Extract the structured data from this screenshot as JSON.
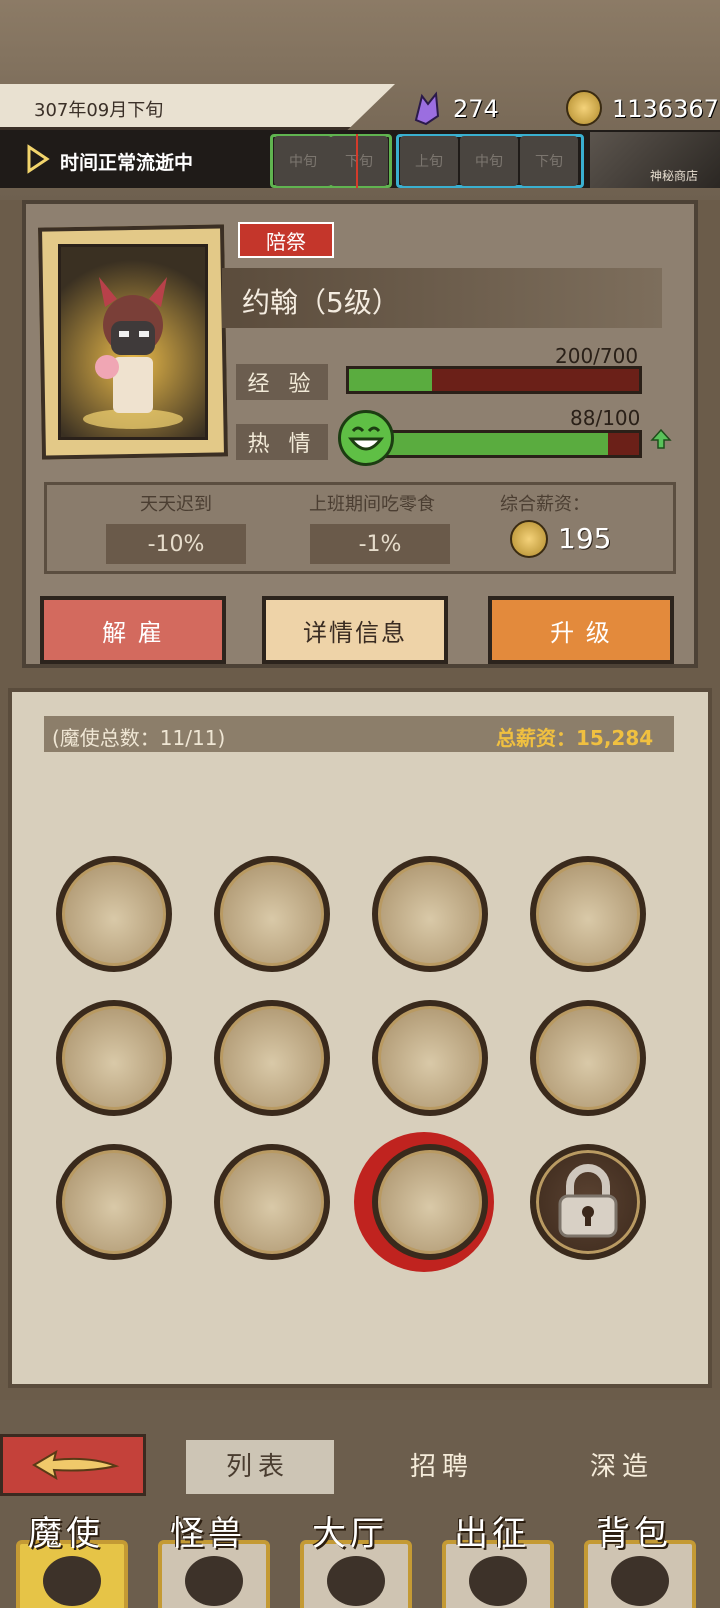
{
  "header": {
    "date": "307年09月下旬",
    "crystals": "274",
    "gold": "1136367"
  },
  "time_bar": {
    "status": "时间正常流逝中",
    "slots_current": [
      "中旬",
      "下旬"
    ],
    "slots_next": [
      "上旬",
      "中旬",
      "下旬"
    ],
    "shop_label": "神秘商店"
  },
  "character": {
    "tag": "陪祭",
    "name": "约翰（5级）",
    "exp_label": "经 验",
    "exp_value": "200/700",
    "exp_progress": 0.2857,
    "passion_label": "热 情",
    "passion_value": "88/100",
    "passion_progress": 0.88,
    "traits": [
      {
        "name": "天天迟到",
        "value": "-10%"
      },
      {
        "name": "上班期间吃零食",
        "value": "-1%"
      }
    ],
    "salary_label": "综合薪资：",
    "salary_value": "195"
  },
  "actions": {
    "fire": "解 雇",
    "detail": "详情信息",
    "upgrade": "升 级"
  },
  "roster": {
    "count_label": "(魔使总数：11/11)",
    "total_salary": "总薪资：15,284"
  },
  "sub_tabs": {
    "list": "列表",
    "recruit": "招聘",
    "forge": "深造"
  },
  "nav": {
    "items": [
      "魔使",
      "怪兽",
      "大厅",
      "出征",
      "背包"
    ]
  },
  "colors": {
    "progress_green": "#5aac3f",
    "progress_empty": "#6b2018",
    "gold_text": "#f0c040",
    "fire_red": "#d36a5e",
    "upgrade_orange": "#e38a3c"
  }
}
